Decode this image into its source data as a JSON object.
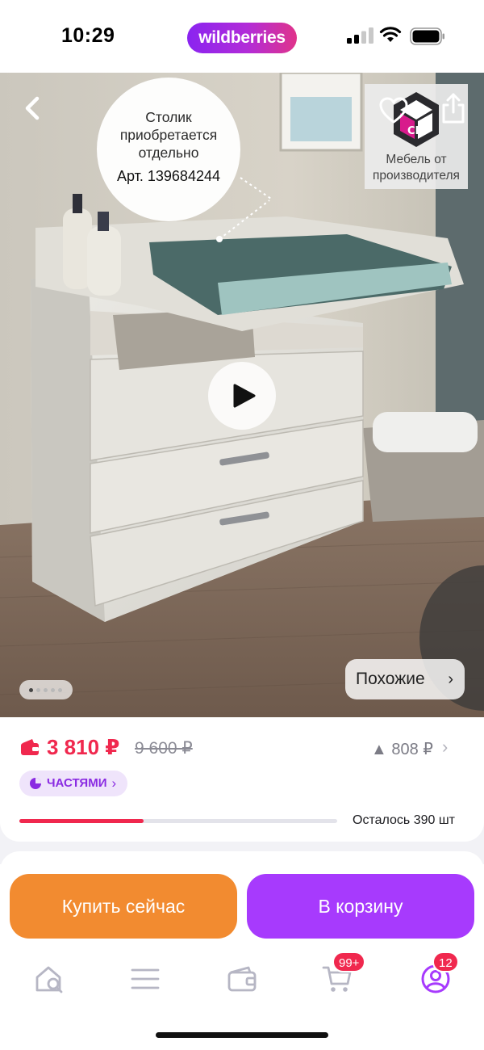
{
  "status_bar": {
    "time": "10:29",
    "brand": "wildberries"
  },
  "hero": {
    "note": "Столик приобретается отдельно",
    "article": "Арт. 139684244",
    "maker_badge": "Мебель от производителя",
    "maker_logo_letters": "СМ",
    "similar_label": "Похожие",
    "similar_chevron": "›",
    "gallery_total": 5,
    "gallery_active": 1
  },
  "price": {
    "current": "3 810 ₽",
    "old": "9 600 ₽",
    "delta": "▲ 808 ₽",
    "delta_chevron": "›",
    "installments": "ЧАСТЯМИ",
    "installments_chevron": "›",
    "stock_text": "Осталось 390 шт",
    "stock_progress": 0.39
  },
  "actions": {
    "buy_now": "Купить сейчас",
    "to_cart": "В корзину"
  },
  "tabbar": {
    "cart_badge": "99+",
    "profile_badge": "12"
  },
  "colors": {
    "accent_red": "#f0284e",
    "brand_purple": "#a73afd",
    "buy_orange": "#f28b30",
    "tab_icon": "#b6b6c4"
  },
  "icons": [
    "back-icon",
    "heart-icon",
    "share-icon",
    "play-icon",
    "wallet-icon",
    "pie-chart-icon",
    "home-search-icon",
    "menu-icon",
    "wallet-tab-icon",
    "cart-icon",
    "profile-icon"
  ]
}
